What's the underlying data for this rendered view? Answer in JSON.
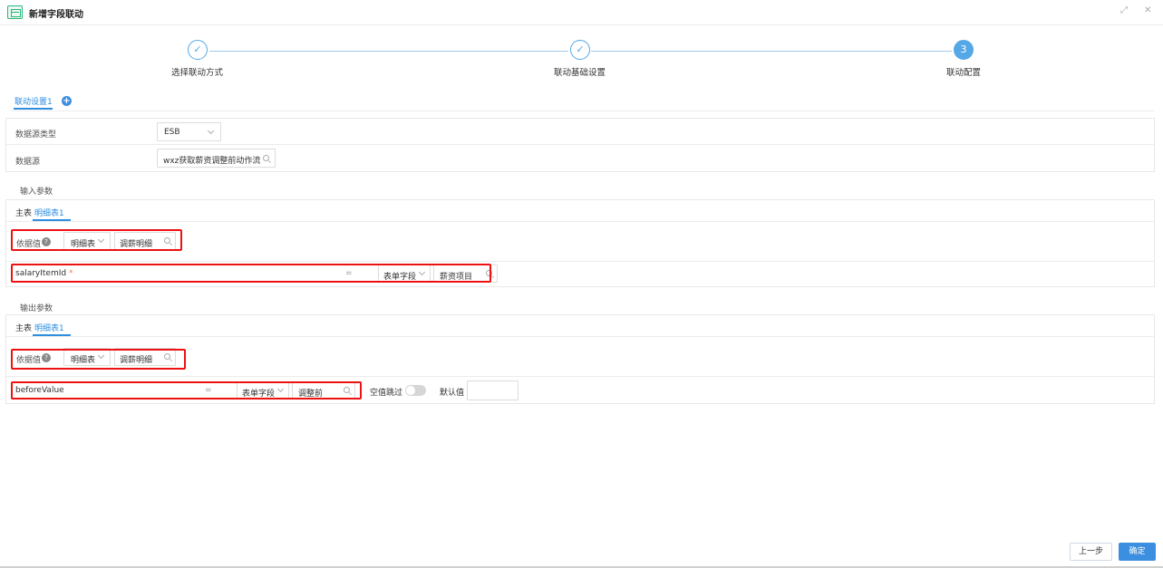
{
  "header": {
    "title": "新增字段联动"
  },
  "steps": [
    {
      "label": "选择联动方式",
      "mark": "✓"
    },
    {
      "label": "联动基础设置",
      "mark": "✓"
    },
    {
      "label": "联动配置",
      "mark": "3"
    }
  ],
  "linkage_tabs": {
    "active": "联动设置1",
    "add": "+"
  },
  "basic": {
    "source_type_label": "数据源类型",
    "source_type_value": "ESB",
    "source_label": "数据源",
    "source_value": "wxz获取薪资调整前动作流"
  },
  "input": {
    "section_title": "输入参数",
    "tabs": [
      "主表",
      "明细表1"
    ],
    "basis_label": "依据值",
    "basis_type": "明细表",
    "basis_value": "调薪明细",
    "param_name": "salaryItemId",
    "required_mark": "*",
    "op": "=",
    "field_type": "表单字段",
    "field_value": "薪资项目"
  },
  "output": {
    "section_title": "输出参数",
    "tabs": [
      "主表",
      "明细表1"
    ],
    "basis_label": "依据值",
    "basis_type": "明细表",
    "basis_value": "调薪明细",
    "param_name": "beforeValue",
    "op": "=",
    "field_type": "表单字段",
    "field_value": "调整前",
    "skip_empty_label": "空值跳过",
    "skip_empty_on": false,
    "default_label": "默认值",
    "default_value": ""
  },
  "footer": {
    "prev_label": "上一步",
    "confirm_label": "确定"
  }
}
